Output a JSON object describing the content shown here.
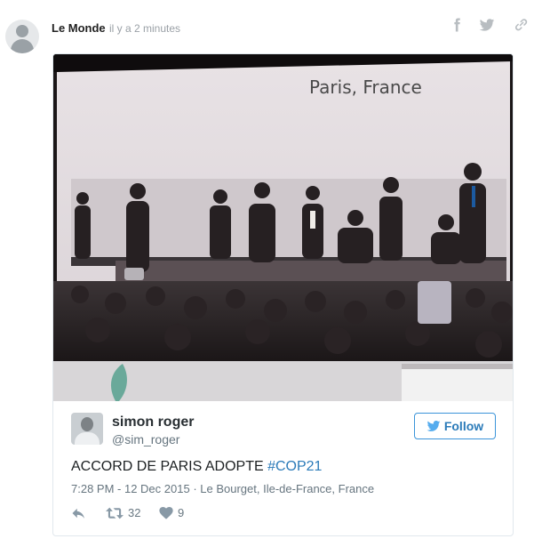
{
  "post": {
    "author": "Le Monde",
    "time": "il y a 2 minutes",
    "share_icons": [
      "facebook-icon",
      "twitter-icon",
      "link-icon"
    ]
  },
  "tweet": {
    "photo_caption_text": "Paris, France",
    "user": {
      "name": "simon roger",
      "handle": "@sim_roger"
    },
    "follow_label": "Follow",
    "text": "ACCORD DE PARIS ADOPTE ",
    "hashtag": "#COP21",
    "timestamp": "7:28 PM - 12 Dec 2015",
    "separator": " · ",
    "location": "Le Bourget, Ile-de-France, France",
    "retweets": "32",
    "likes": "9",
    "colors": {
      "link": "#2b7bb9",
      "twitter_blue": "#55acee",
      "muted": "#66757f"
    }
  }
}
